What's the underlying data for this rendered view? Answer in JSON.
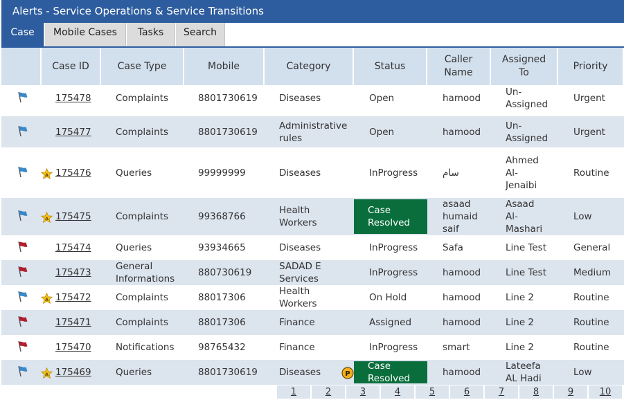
{
  "title": "Alerts - Service Operations & Service Transitions",
  "tabs": [
    "Case",
    "Mobile Cases",
    "Tasks",
    "Search"
  ],
  "columns": [
    "Case ID",
    "Case Type",
    "Mobile",
    "Category",
    "Status",
    "Caller Name",
    "Assigned To",
    "Priority"
  ],
  "colors": {
    "header": "#2e5d9f",
    "resolved": "#0a6e3c",
    "flag_blue": "#3a88c8",
    "flag_red": "#b01e2d"
  },
  "rows": [
    {
      "flag": "blue",
      "star": false,
      "case_id": "175478",
      "case_type": "Complaints",
      "mobile": "8801730619",
      "category": "Diseases",
      "status": "Open",
      "caller": "hamood",
      "assigned": "Un-\nAssigned",
      "priority": "Urgent"
    },
    {
      "flag": "blue",
      "star": false,
      "case_id": "175477",
      "case_type": "Complaints",
      "mobile": "8801730619",
      "category": "Administrative rules",
      "status": "Open",
      "caller": "hamood",
      "assigned": "Un-\nAssigned",
      "priority": "Urgent"
    },
    {
      "flag": "blue",
      "star": true,
      "case_id": "175476",
      "case_type": "Queries",
      "mobile": "99999999",
      "category": "Diseases",
      "status": "InProgress",
      "caller": "سام",
      "assigned": "Ahmed\nAl-\nJenaibi",
      "priority": "Routine"
    },
    {
      "flag": "blue",
      "star": true,
      "case_id": "175475",
      "case_type": "Complaints",
      "mobile": "99368766",
      "category": "Health Workers",
      "status": "Case Resolved",
      "caller": "asaad humaid saif",
      "assigned": "Asaad\nAl-\nMashari",
      "priority": "Low"
    },
    {
      "flag": "red",
      "star": false,
      "case_id": "175474",
      "case_type": "Queries",
      "mobile": "93934665",
      "category": "Diseases",
      "status": "InProgress",
      "caller": "Safa",
      "assigned": "Line Test",
      "priority": "General"
    },
    {
      "flag": "red",
      "star": false,
      "case_id": "175473",
      "case_type": "General Informations",
      "mobile": "880730619",
      "category": "SADAD E Services",
      "status": "InProgress",
      "caller": "hamood",
      "assigned": "Line Test",
      "priority": "Medium"
    },
    {
      "flag": "blue",
      "star": true,
      "case_id": "175472",
      "case_type": "Complaints",
      "mobile": "88017306",
      "category": "Health Workers",
      "status": "On Hold",
      "caller": "hamood",
      "assigned": "Line 2",
      "priority": "Routine"
    },
    {
      "flag": "red",
      "star": false,
      "case_id": "175471",
      "case_type": "Complaints",
      "mobile": "88017306",
      "category": "Finance",
      "status": "Assigned",
      "caller": "hamood",
      "assigned": "Line 2",
      "priority": "Routine"
    },
    {
      "flag": "red",
      "star": false,
      "case_id": "175470",
      "case_type": "Notifications",
      "mobile": "98765432",
      "category": "Finance",
      "status": "InProgress",
      "caller": "smart",
      "assigned": "Line 2",
      "priority": "Routine"
    },
    {
      "flag": "blue",
      "star": true,
      "case_id": "175469",
      "case_type": "Queries",
      "mobile": "8801730619",
      "category": "Diseases",
      "category_badge": "P",
      "status": "Case Resolved",
      "caller": "hamood",
      "assigned": "Lateefa\nAL Hadi",
      "priority": "Low"
    }
  ],
  "pages": [
    "1",
    "2",
    "3",
    "4",
    "5",
    "6",
    "7",
    "8",
    "9",
    "10"
  ]
}
